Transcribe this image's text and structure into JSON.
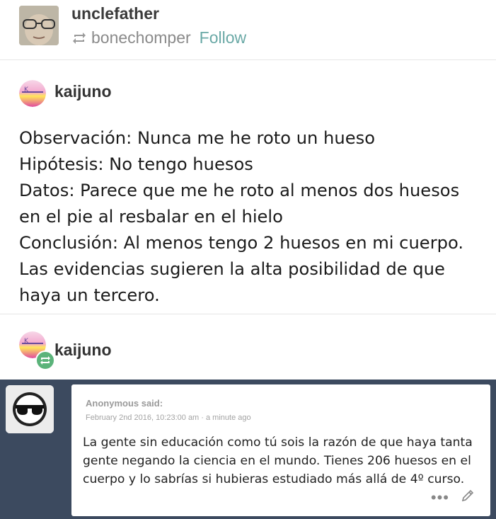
{
  "header": {
    "username": "unclefather",
    "reblogged_from": "bonechomper",
    "follow_label": "Follow",
    "icons": {
      "reblog": "reblog-icon"
    }
  },
  "post1": {
    "author": "kaijuno",
    "body": "Observación: Nunca me he roto un hueso\nHipótesis: No tengo huesos\nDatos: Parece que me he roto al menos dos huesos en el pie al resbalar en el hielo\nConclusión: Al menos tengo 2 huesos en mi cuerpo. Las evidencias sugieren la alta posibilidad de que haya un tercero."
  },
  "post2": {
    "author": "kaijuno",
    "icons": {
      "badge": "reblog-badge-icon"
    }
  },
  "ask": {
    "asker": "Anonymous said:",
    "meta": "February 2nd 2016, 10:23:00 am · a minute ago",
    "text": "La gente sin educación como tú sois la razón de que haya tanta gente negando la ciencia en el mundo. Tienes 206 huesos en el cuerpo y lo sabrías si hubieras estudiado más allá de 4º curso.",
    "icons": {
      "more": "more-icon",
      "edit": "pencil-icon",
      "avatar": "sunglasses-avatar-icon"
    }
  },
  "colors": {
    "follow": "#6aa9a6",
    "ask_background": "#3c4a5f",
    "reblog_badge": "#5bb37a"
  }
}
